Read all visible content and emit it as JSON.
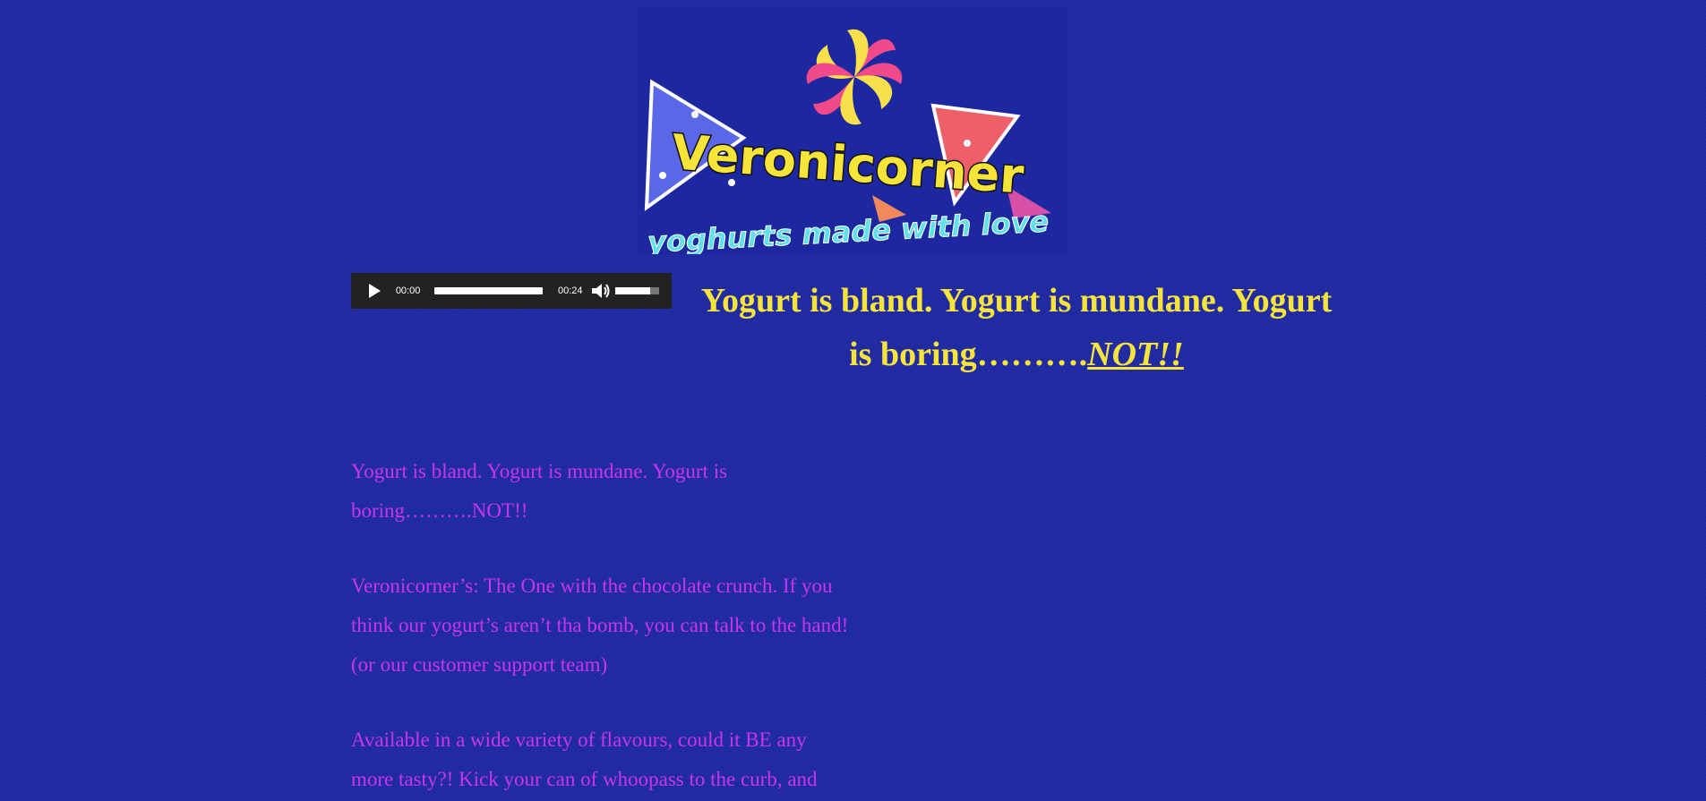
{
  "logo": {
    "title": "Veronicorner",
    "tagline": "yoghurts made with love"
  },
  "audio_player": {
    "current_time": "00:00",
    "duration": "00:24",
    "progress": 0,
    "volume": 0.8
  },
  "headline": {
    "text": "Yogurt is bland.  Yogurt is mundane.  Yogurt is boring……….",
    "emphasis": "NOT!!"
  },
  "paragraphs": [
    "Yogurt is bland.  Yogurt is mundane.  Yogurt is boring……….NOT!!",
    "Veronicorner’s: The One with the chocolate crunch.  If you think our yogurt’s aren’t tha bomb, you can talk to the hand!  (or our customer support team)",
    "Available in a wide variety of flavours, could it BE any more tasty?!  Kick your can of whoopass to the curb, and"
  ],
  "colors": {
    "background": "#1f2aa3",
    "headline": "#f7e43b",
    "body_text": "#cc33ee",
    "player": "#222222"
  }
}
